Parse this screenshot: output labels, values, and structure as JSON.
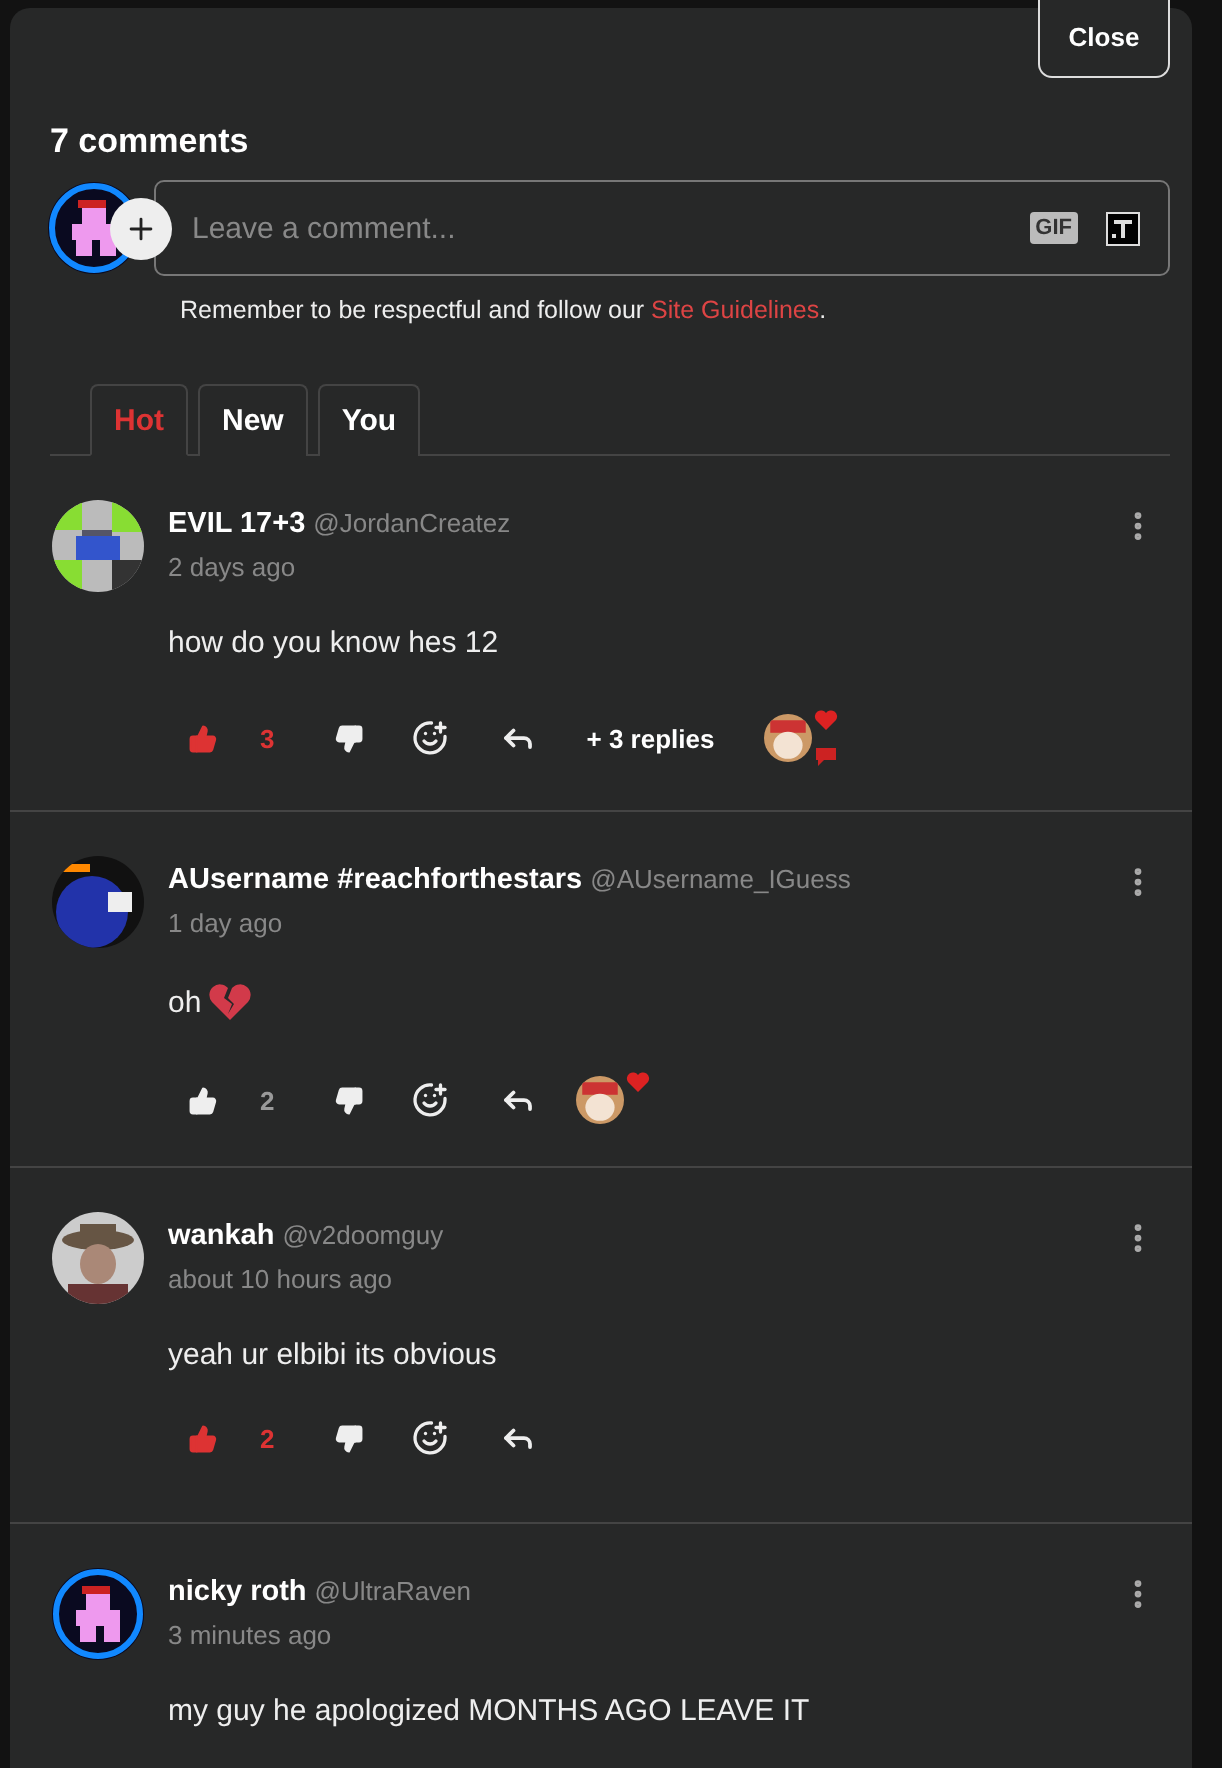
{
  "close_button": "Close",
  "heading": "7 comments",
  "composer": {
    "placeholder": "Leave a comment...",
    "gif_button": "GIF",
    "notice": "Remember to be respectful and follow our ",
    "notice_link": "Site Guidelines",
    "notice_end": "."
  },
  "tabs": [
    {
      "label": "Hot",
      "selected": true
    },
    {
      "label": "New",
      "selected": false
    },
    {
      "label": "You",
      "selected": false
    }
  ],
  "comments": [
    {
      "name": "EVIL 17+3",
      "handle": "@JordanCreatez",
      "time": "2 days ago",
      "text": "how do you know hes 12",
      "liked": true,
      "likes": "3",
      "replies": "+ 3 replies",
      "reactions": [
        {
          "kind": "heart"
        },
        {
          "kind": "bubble"
        }
      ]
    },
    {
      "name": "AUsername #reachforthestars",
      "handle": "@AUsername_IGuess",
      "time": "1 day ago",
      "text": "oh",
      "emoji": {
        "kind": "broken-heart"
      },
      "liked": false,
      "likes": "2",
      "reactions": [
        {
          "kind": "heart"
        }
      ]
    },
    {
      "name": "wankah",
      "handle": "@v2doomguy",
      "time": "about 10 hours ago",
      "text": "yeah ur elbibi its obvious",
      "liked": true,
      "likes": "2"
    },
    {
      "name": "nicky roth",
      "handle": "@UltraRaven",
      "time": "3 minutes ago",
      "text": "my guy he apologized MONTHS AGO LEAVE IT"
    }
  ]
}
